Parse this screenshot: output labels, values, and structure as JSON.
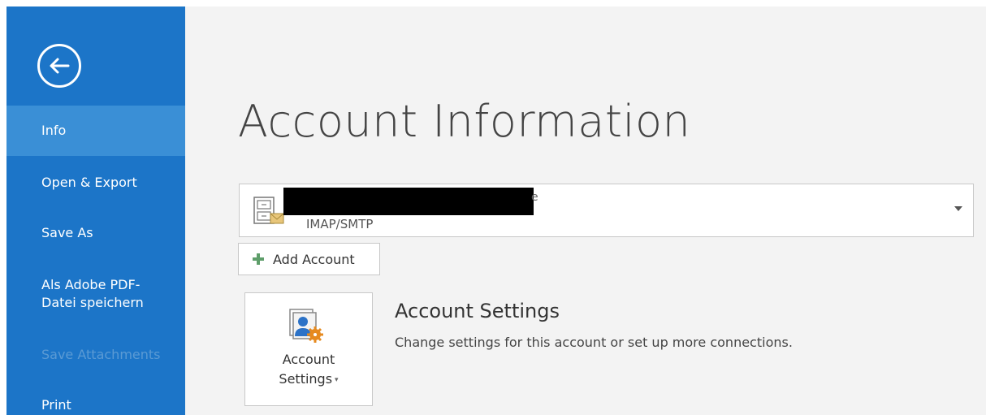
{
  "sidebar": {
    "back_icon": "back-arrow-icon",
    "items": [
      {
        "label": "Info",
        "active": true
      },
      {
        "label": "Open & Export"
      },
      {
        "label": "Save As"
      },
      {
        "label": "Als Adobe PDF-",
        "label2": "Datei speichern"
      },
      {
        "label": "Save Attachments",
        "disabled": true
      },
      {
        "label": "Print"
      }
    ]
  },
  "main": {
    "title": "Account Information",
    "account": {
      "type": "IMAP/SMTP",
      "tail_char": "e",
      "icon": "mailbox-icon"
    },
    "add_account_label": "Add Account",
    "settings_tile": {
      "line1": "Account",
      "line2": "Settings",
      "caret": "▾",
      "icon": "account-settings-icon"
    },
    "section": {
      "heading": "Account Settings",
      "description": "Change settings for this account or set up more connections."
    }
  },
  "colors": {
    "sidebar": "#1c75c8",
    "sidebar_active": "#3a8fd6",
    "background": "#f3f3f3"
  }
}
